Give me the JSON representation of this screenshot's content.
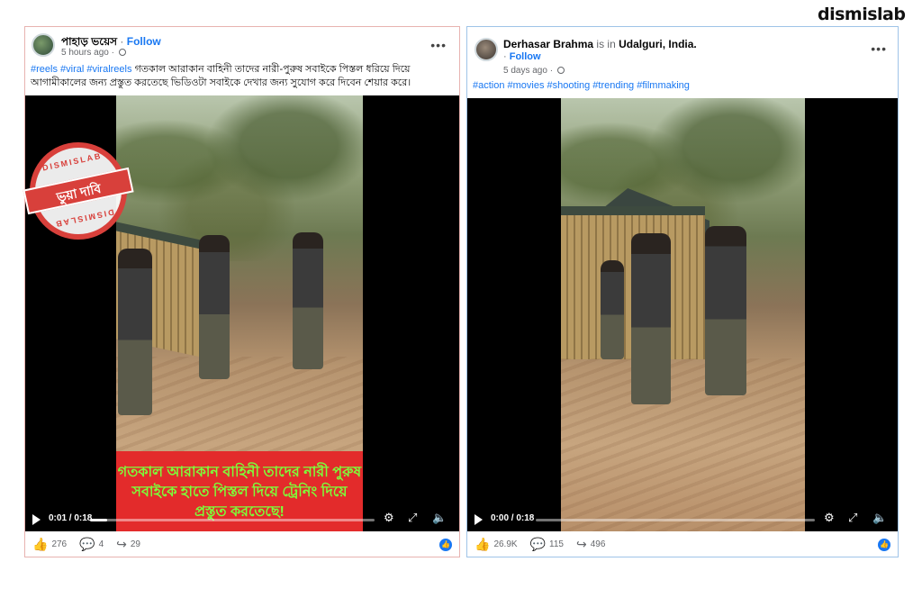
{
  "brand": {
    "logo_text": "dismislab"
  },
  "left_post": {
    "author": "পাহাড় ভয়েস",
    "follow_label": "Follow",
    "time_ago": "5 hours ago",
    "caption_tags": "#reels #viral #viralreels",
    "caption_text": "গতকাল আরাকান বাহিনী তাদের নারী-পুরুষ সবাইকে পিস্তল ধরিয়ে দিয়ে আগামীকালের জন্য প্রস্তুত করতেছে ভিডিওটা সবাইকে দেখার জন্য সুযোগ করে দিবেন শেয়ার করে।",
    "video_subtitle": "গতকাল আরাকান বাহিনী তাদের নারী পুরুষ সবাইকে হাতে পিস্তল দিয়ে ট্রেনিং দিয়ে প্রস্তুত করতেছে!",
    "video_time": "0:01 / 0:18",
    "progress_fraction": 0.06,
    "reactions": "276",
    "comments": "4",
    "shares": "29",
    "stamp": {
      "top": "DISMISLAB",
      "label": "ভুয়া দাবি",
      "bottom": "DISMISLAB",
      "color": "#d8403b"
    }
  },
  "right_post": {
    "author": "Derhasar Brahma",
    "checkin_prefix": "is in",
    "location": "Udalguri, India.",
    "follow_label": "Follow",
    "time_ago": "5 days ago",
    "caption_tags": "#action #movies #shooting #trending #filmmaking",
    "video_time": "0:00 / 0:18",
    "progress_fraction": 0.0,
    "reactions": "26.9K",
    "comments": "115",
    "shares": "496"
  },
  "icons": [
    "more-icon",
    "globe-icon",
    "play-icon",
    "settings-icon",
    "fullscreen-icon",
    "mute-icon",
    "like-icon",
    "comment-icon",
    "share-icon"
  ],
  "colors": {
    "link": "#1877f2",
    "subtitle_bg": "#e32b2b",
    "subtitle_text": "#7cff3a"
  }
}
